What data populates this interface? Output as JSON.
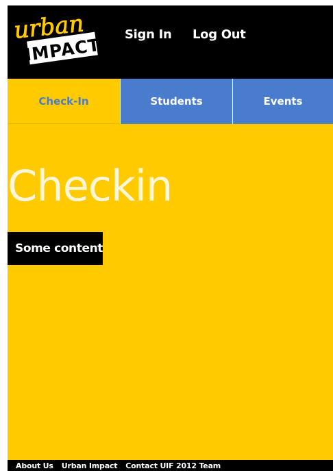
{
  "header": {
    "logo": {
      "line1": "urban",
      "line2": "IMPACT",
      "name": "urban-impact-logo"
    },
    "sign_in": "Sign In",
    "log_out": "Log Out"
  },
  "tabs": [
    {
      "label": "Check-In",
      "active": true
    },
    {
      "label": "Students",
      "active": false
    },
    {
      "label": "Events",
      "active": false
    }
  ],
  "main": {
    "title": "Checkin",
    "content": "Some content"
  },
  "footer": {
    "links": [
      "About Us",
      "Urban Impact",
      "Contact UIF 2012 Team"
    ]
  },
  "colors": {
    "background": "#ffca00",
    "tab_blue": "#4a7ccd",
    "header": "#000000",
    "title": "#fff6d8",
    "logo_yellow": "#ffca00"
  }
}
